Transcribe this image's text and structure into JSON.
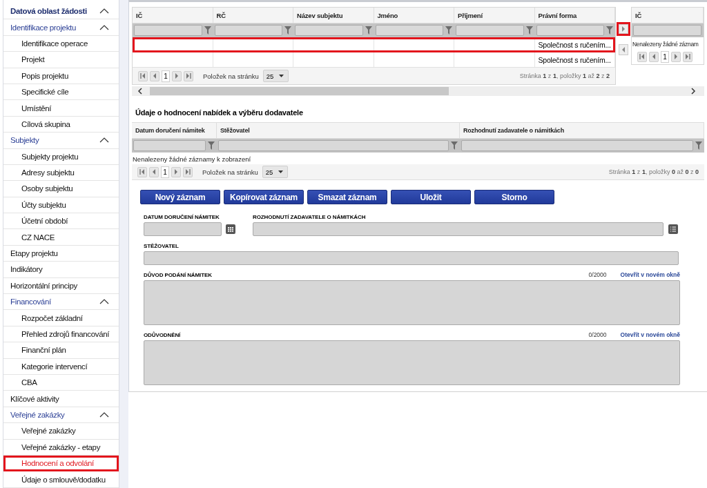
{
  "sidebar": {
    "items": [
      {
        "label": "Datová oblast žádosti",
        "kind": "root",
        "expanded": true
      },
      {
        "label": "Identifikace projektu",
        "kind": "group",
        "expanded": true,
        "children": [
          {
            "label": "Identifikace operace",
            "selected": false
          },
          {
            "label": "Projekt",
            "selected": false
          },
          {
            "label": "Popis projektu",
            "selected": false
          },
          {
            "label": "Specifické cíle",
            "selected": false
          },
          {
            "label": "Umístění",
            "selected": false
          },
          {
            "label": "Cílová skupina",
            "selected": false
          }
        ]
      },
      {
        "label": "Subjekty",
        "kind": "group",
        "expanded": true,
        "children": [
          {
            "label": "Subjekty projektu",
            "selected": false
          },
          {
            "label": "Adresy subjektu",
            "selected": false
          },
          {
            "label": "Osoby subjektu",
            "selected": false
          },
          {
            "label": "Účty subjektu",
            "selected": false
          },
          {
            "label": "Účetní období",
            "selected": false
          },
          {
            "label": "CZ NACE",
            "selected": false
          }
        ]
      },
      {
        "label": "Etapy projektu",
        "kind": "item",
        "selected": false
      },
      {
        "label": "Indikátory",
        "kind": "item",
        "selected": false
      },
      {
        "label": "Horizontální principy",
        "kind": "item",
        "selected": false
      },
      {
        "label": "Financování",
        "kind": "group",
        "expanded": true,
        "children": [
          {
            "label": "Rozpočet základní",
            "selected": false
          },
          {
            "label": "Přehled zdrojů financování",
            "selected": false
          },
          {
            "label": "Finanční plán",
            "selected": false
          },
          {
            "label": "Kategorie intervencí",
            "selected": false
          },
          {
            "label": "CBA",
            "selected": false
          }
        ]
      },
      {
        "label": "Klíčové aktivity",
        "kind": "item",
        "selected": false
      },
      {
        "label": "Veřejné zakázky",
        "kind": "group",
        "expanded": true,
        "children": [
          {
            "label": "Veřejné zakázky",
            "selected": false
          },
          {
            "label": "Veřejné zakázky - etapy",
            "selected": false
          },
          {
            "label": "Hodnocení a odvolání",
            "selected": true
          },
          {
            "label": "Údaje o smlouvě/dodatku",
            "selected": false
          }
        ]
      }
    ]
  },
  "subjects_grid": {
    "columns": [
      "IČ",
      "RČ",
      "Název subjektu",
      "Jméno",
      "Příjmení",
      "Právní forma"
    ],
    "rows": [
      {
        "legal_form": "Společnost s ručením...",
        "highlighted": true
      },
      {
        "legal_form": "Společnost s ručením...",
        "highlighted": false
      }
    ],
    "pager": {
      "page": "1",
      "page_size_label": "Položek na stránku",
      "page_size": "25",
      "summary": "Stránka **1** z **1**, položky **1** až **2** z **2**"
    }
  },
  "scroll_right_button": {
    "highlighted": true
  },
  "side_grid": {
    "columns": [
      "IČ"
    ],
    "empty_message": "Nenalezeny žádné záznam",
    "pager": {
      "page": "1"
    }
  },
  "evaluation": {
    "title": "Údaje o hodnocení nabídek a výběru dodavatele",
    "columns": [
      "Datum doručení námitek",
      "Stěžovatel",
      "Rozhodnutí zadavatele o námitkách"
    ],
    "empty_message": "Nenalezeny žádné záznamy k zobrazení",
    "pager": {
      "page": "1",
      "page_size_label": "Položek na stránku",
      "page_size": "25",
      "summary": "Stránka **1** z **1**, položky **0** až **0** z **0**"
    },
    "buttons": [
      "Nový záznam",
      "Kopírovat záznam",
      "Smazat záznam",
      "Uložit",
      "Storno"
    ],
    "form": {
      "rows": [
        {
          "fields": [
            {
              "kind": "date",
              "label": "DATUM DORUČENÍ NÁMITEK"
            },
            {
              "kind": "select",
              "label": "ROZHODNUTÍ ZADAVATELE O NÁMITKÁCH"
            }
          ]
        },
        {
          "fields": [
            {
              "kind": "text",
              "label": "STĚŽOVATEL"
            }
          ]
        },
        {
          "fields": [
            {
              "kind": "textarea",
              "label": "DŮVOD PODÁNÍ NÁMITEK",
              "counter": "0/2000",
              "link": "Otevřít v novém okně"
            }
          ]
        },
        {
          "fields": [
            {
              "kind": "textarea",
              "label": "ODŮVODNĚNÍ",
              "counter": "0/2000",
              "link": "Otevřít v novém okně"
            }
          ]
        }
      ]
    }
  }
}
